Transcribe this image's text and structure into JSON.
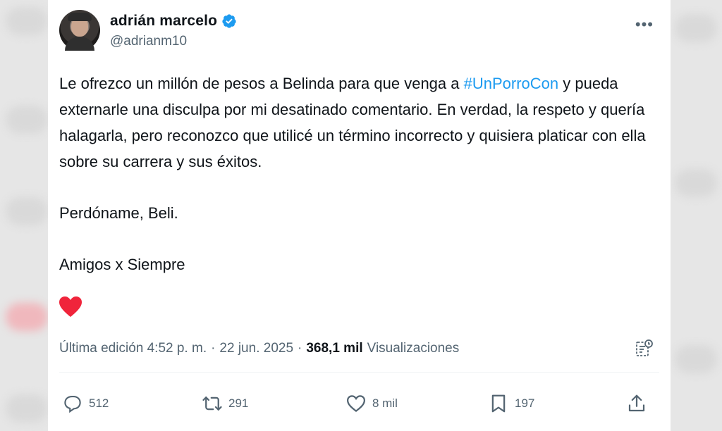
{
  "author": {
    "name": "adrián marcelo",
    "handle": "@adrianm10"
  },
  "tweet": {
    "line1_before": "Le ofrezco un millón de pesos a Belinda para que venga a ",
    "hashtag": "#UnPorroCon",
    "line1_after": " y pueda externarle una disculpa por mi desatinado comentario. En verdad, la respeto y quería halagarla, pero reconozco que utilicé un término incorrecto y quisiera platicar con ella sobre su carrera y sus éxitos.",
    "paragraph2": "Perdóname, Beli.",
    "paragraph3": "Amigos x Siempre"
  },
  "meta": {
    "edited_label": "Última edición 4:52 p. m.",
    "separator": "·",
    "date": "22 jun. 2025",
    "separator2": "·",
    "views_count": "368,1 mil",
    "views_label": "Visualizaciones"
  },
  "actions": {
    "replies": "512",
    "retweets": "291",
    "likes": "8 mil",
    "bookmarks": "197"
  },
  "colors": {
    "accent": "#1d9bf0",
    "secondary_text": "#536471",
    "heart": "#f91880"
  },
  "icons": [
    "verified-badge-icon",
    "more-icon",
    "heart-emoji-icon",
    "edit-history-icon",
    "reply-icon",
    "retweet-icon",
    "like-icon",
    "bookmark-icon",
    "share-icon"
  ]
}
